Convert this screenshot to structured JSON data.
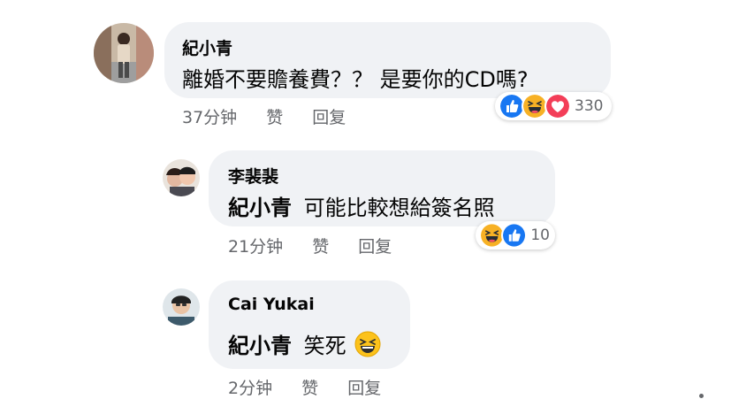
{
  "comments": [
    {
      "author": "紀小青",
      "text": "離婚不要贍養費？？ 是要你的CD嗎?",
      "time": "37分钟",
      "like_label": "赞",
      "reply_label": "回复",
      "reaction_icons": [
        "like-icon",
        "haha-icon",
        "love-icon"
      ],
      "reaction_count": "330"
    },
    {
      "author": "李裴裴",
      "mention": "紀小青",
      "text": "可能比較想給簽名照",
      "time": "21分钟",
      "like_label": "赞",
      "reply_label": "回复",
      "reaction_icons": [
        "haha-icon",
        "like-icon"
      ],
      "reaction_count": "10"
    },
    {
      "author": "Cai Yukai",
      "mention": "紀小青",
      "text": "笑死",
      "inline_emoji": "laughing-emoji-icon",
      "time": "2分钟",
      "like_label": "赞",
      "reply_label": "回复"
    }
  ],
  "colors": {
    "bubble_bg": "#f0f2f5",
    "like_blue": "#1877f2",
    "love_red": "#f33e58",
    "haha_yellow": "#f7b125",
    "meta_gray": "#65676b"
  }
}
